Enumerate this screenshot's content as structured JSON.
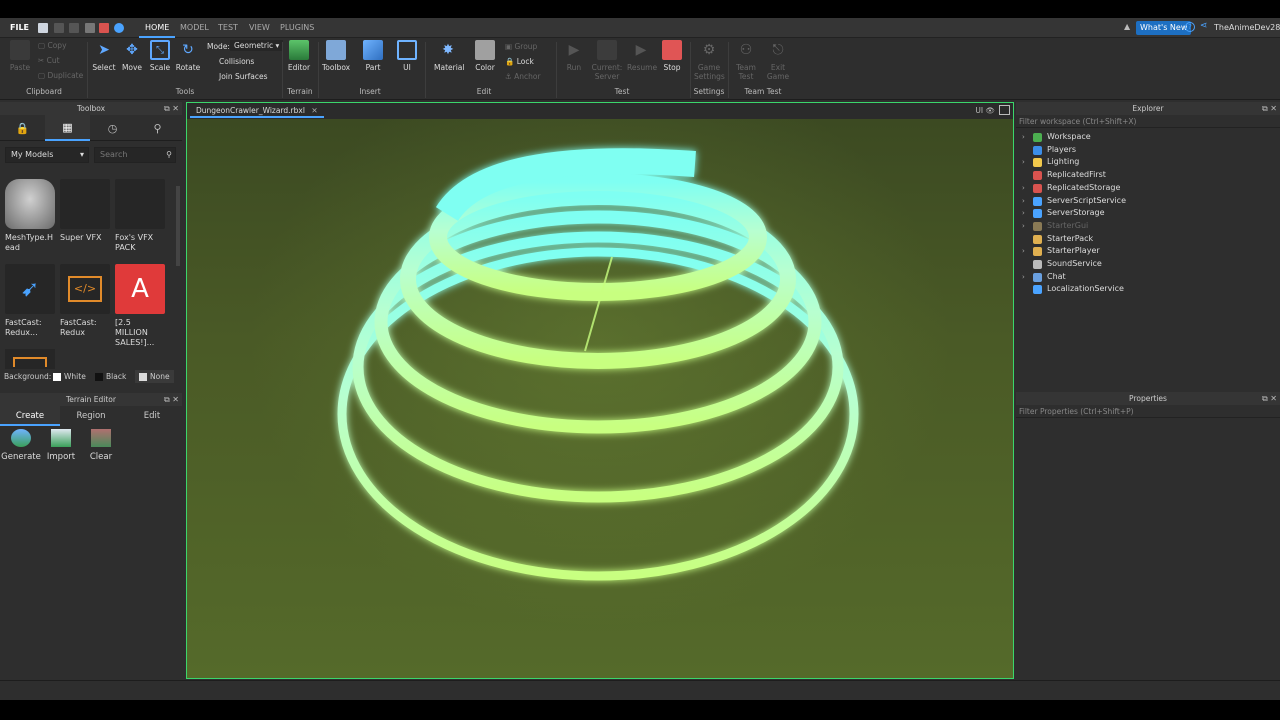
{
  "menu": {
    "file": "FILE",
    "tabs": [
      "HOME",
      "MODEL",
      "TEST",
      "VIEW",
      "PLUGINS"
    ],
    "active_tab": "HOME",
    "whats_new": "What's New",
    "user": "TheAnimeDev28"
  },
  "ribbon": {
    "clipboard": {
      "paste": "Paste",
      "copy": "Copy",
      "cut": "Cut",
      "duplicate": "Duplicate",
      "label": "Clipboard"
    },
    "tools": {
      "select": "Select",
      "move": "Move",
      "scale": "Scale",
      "rotate": "Rotate",
      "mode_label": "Mode:",
      "mode_value": "Geometric",
      "collisions": "Collisions",
      "join_surfaces": "Join Surfaces",
      "label": "Tools"
    },
    "terrain": {
      "editor": "Editor",
      "label": "Terrain"
    },
    "insert": {
      "toolbox": "Toolbox",
      "part": "Part",
      "ui": "UI",
      "label": "Insert"
    },
    "edit": {
      "material": "Material",
      "color": "Color",
      "group": "Group",
      "lock": "Lock",
      "anchor": "Anchor",
      "label": "Edit"
    },
    "test": {
      "run": "Run",
      "current_server": "Current: Server",
      "resume": "Resume",
      "stop": "Stop",
      "label": "Test"
    },
    "settings": {
      "game_settings": "Game Settings",
      "label": "Settings"
    },
    "team_test": {
      "team_test": "Team Test",
      "exit_game": "Exit Game",
      "label": "Team Test"
    }
  },
  "toolbox": {
    "title": "Toolbox",
    "category": "My Models",
    "search_placeholder": "Search",
    "assets": [
      {
        "name": "MeshType.H ead"
      },
      {
        "name": "Super VFX"
      },
      {
        "name": "Fox's VFX PACK"
      },
      {
        "name": "FastCast: Redux..."
      },
      {
        "name": "FastCast: Redux"
      },
      {
        "name": "[2.5 MILLION SALES!]..."
      }
    ],
    "background_label": "Background:",
    "bg_options": [
      "White",
      "Black",
      "None"
    ]
  },
  "terrain_editor": {
    "title": "Terrain Editor",
    "tabs": [
      "Create",
      "Region",
      "Edit"
    ],
    "buttons": [
      "Generate",
      "Import",
      "Clear"
    ]
  },
  "viewport": {
    "doc_tab": "DungeonCrawler_Wizard.rbxl",
    "ui_toggle": "UI"
  },
  "explorer": {
    "title": "Explorer",
    "filter_placeholder": "Filter workspace (Ctrl+Shift+X)",
    "items": [
      {
        "label": "Workspace",
        "color": "#4caf50",
        "arrow": true
      },
      {
        "label": "Players",
        "color": "#3c8ee8",
        "arrow": false
      },
      {
        "label": "Lighting",
        "color": "#f2c94c",
        "arrow": true
      },
      {
        "label": "ReplicatedFirst",
        "color": "#d9534f",
        "arrow": false
      },
      {
        "label": "ReplicatedStorage",
        "color": "#d9534f",
        "arrow": true
      },
      {
        "label": "ServerScriptService",
        "color": "#4aa3ff",
        "arrow": true
      },
      {
        "label": "ServerStorage",
        "color": "#4aa3ff",
        "arrow": true
      },
      {
        "label": "StarterGui",
        "color": "#8a7a55",
        "arrow": true,
        "dim": true
      },
      {
        "label": "StarterPack",
        "color": "#e0b050",
        "arrow": false
      },
      {
        "label": "StarterPlayer",
        "color": "#e0b050",
        "arrow": true
      },
      {
        "label": "SoundService",
        "color": "#bbbbbb",
        "arrow": false
      },
      {
        "label": "Chat",
        "color": "#6aa0e0",
        "arrow": true
      },
      {
        "label": "LocalizationService",
        "color": "#4aa3ff",
        "arrow": false
      }
    ]
  },
  "properties": {
    "title": "Properties",
    "filter_placeholder": "Filter Properties (Ctrl+Shift+P)"
  }
}
